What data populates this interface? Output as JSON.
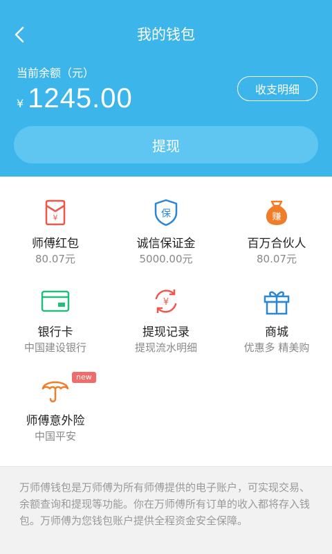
{
  "header": {
    "title": "我的钱包",
    "balance_label": "当前余额（元）",
    "currency": "¥",
    "balance": "1245.00",
    "detail_button": "收支明细",
    "withdraw_button": "提现"
  },
  "grid": [
    {
      "label": "师傅红包",
      "sub": "80.07元",
      "icon": "red-envelope-icon",
      "color": "#f0574a"
    },
    {
      "label": "诚信保证金",
      "sub": "5000.00元",
      "icon": "shield-icon",
      "color": "#2a86d6"
    },
    {
      "label": "百万合伙人",
      "sub": "80.07元",
      "icon": "money-bag-icon",
      "color": "#f07d2a"
    },
    {
      "label": "银行卡",
      "sub": "中国建设银行",
      "icon": "bank-card-icon",
      "color": "#1fbf7a"
    },
    {
      "label": "提现记录",
      "sub": "提现流水明细",
      "icon": "withdraw-record-icon",
      "color": "#f0574a"
    },
    {
      "label": "商城",
      "sub": "优惠多 精美购",
      "icon": "gift-icon",
      "color": "#2a86d6"
    },
    {
      "label": "师傅意外险",
      "sub": "中国平安",
      "icon": "umbrella-icon",
      "color": "#f07d2a",
      "badge": "new"
    }
  ],
  "icon_glyphs": {
    "shield": "保",
    "money_bag": "赚",
    "withdraw": "¥"
  },
  "footer": {
    "text": "万师傅钱包是万师傅为所有师傅提供的电子账户，可实现交易、余额查询和提现等功能。你在万师傅所有订单的收入都将存入钱包。万师傅为您钱包账户提供全程资金安全保障。"
  },
  "colors": {
    "header_bg": "#3cb6ea",
    "withdraw_bg": "#5fc6f1",
    "badge": "#f26b6b"
  }
}
